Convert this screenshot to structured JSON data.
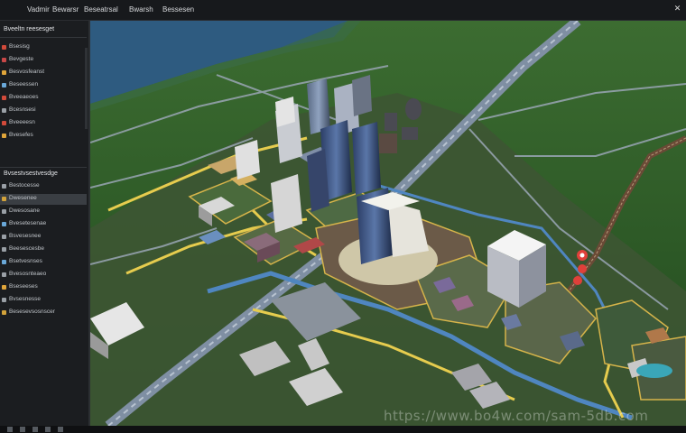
{
  "menu": {
    "items": [
      "Vadmir",
      "Bewarsr",
      "Beseatrsal",
      "Bwarsh",
      "Bessesen"
    ]
  },
  "window": {
    "close_glyph": "✕"
  },
  "sidebar": {
    "header_top": "Bveeltn reesesget",
    "items_group1": [
      {
        "label": "Bsesisg",
        "color": "#d24a3a"
      },
      {
        "label": "Bevgeste",
        "color": "#c94848"
      },
      {
        "label": "Besvosfeanst",
        "color": "#e0a53a"
      },
      {
        "label": "Beseessen",
        "color": "#6aa8d8"
      },
      {
        "label": "Bveeaeoes",
        "color": "#d24a3a"
      },
      {
        "label": "Bcesnsesi",
        "color": "#9aa0a6"
      },
      {
        "label": "Bveeeesn",
        "color": "#d24a3a"
      },
      {
        "label": "Bvesefes",
        "color": "#e0a53a"
      }
    ],
    "header_mid": "Bvsestvsestvesdge",
    "items_group2": [
      {
        "label": "Bestocesse",
        "color": "#9aa0a6"
      },
      {
        "label": "Dwesenee",
        "color": "#d2a23a",
        "selected": true
      },
      {
        "label": "Dwesosane",
        "color": "#9aa0a6"
      },
      {
        "label": "Bvesetesenae",
        "color": "#6aa8d8"
      },
      {
        "label": "Bsvesesnee",
        "color": "#9aa0a6"
      },
      {
        "label": "Beesescesbe",
        "color": "#9aa0a6"
      },
      {
        "label": "Bsetvesnses",
        "color": "#6aa8d8"
      },
      {
        "label": "Bvesosnteaeo",
        "color": "#9aa0a6"
      },
      {
        "label": "Bseseeses",
        "color": "#e0a53a"
      },
      {
        "label": "Bvsesnesse",
        "color": "#9aa0a6"
      },
      {
        "label": "Besesevsosnscer",
        "color": "#d2a23a"
      }
    ]
  },
  "map": {
    "water_color": "#2f5a7e",
    "forest_color": "#2c5a26",
    "road_color": "#8e9aa8",
    "highlight_road_color": "#e3c94a",
    "rail_color": "#5a82b0"
  },
  "watermark": "https://www.bo4w.com/sam-5db.com"
}
